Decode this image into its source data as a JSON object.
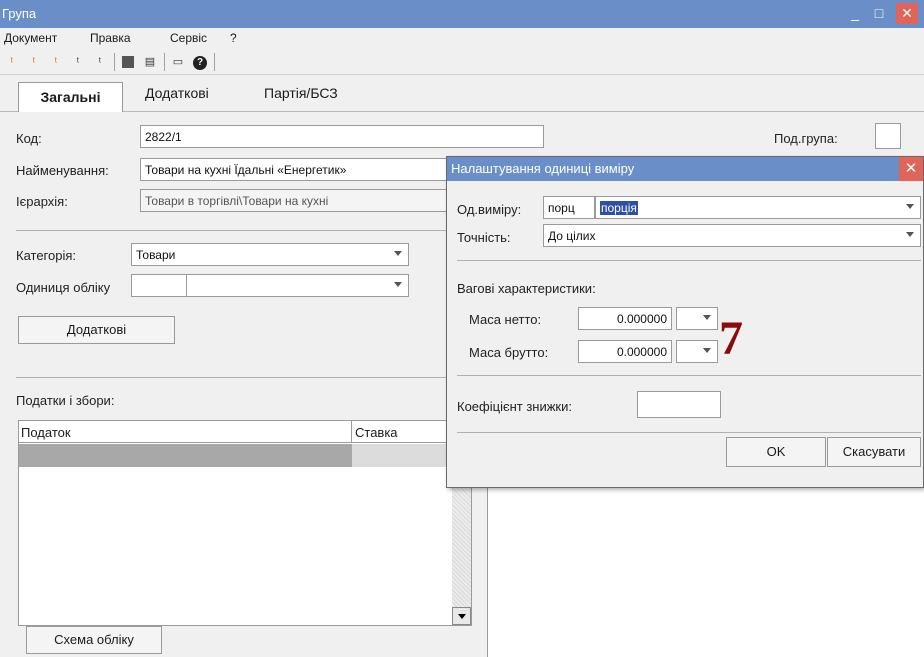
{
  "window": {
    "title": "Група",
    "minimize": "_",
    "maximize": "□",
    "close": "✕"
  },
  "menu": [
    "Документ",
    "Правка",
    "Сервіс",
    "?"
  ],
  "toolbar_icons": [
    "new-doc-icon",
    "new-child-icon",
    "new-copy-icon",
    "new-group-icon",
    "new-item-icon",
    "stop-icon",
    "report-icon",
    "window-icon",
    "help-icon"
  ],
  "tabs": [
    "Загальні",
    "Додаткові",
    "Партія/БСЗ"
  ],
  "form": {
    "code_label": "Код:",
    "code_value": "2822/1",
    "subgroup_label": "Под.група:",
    "name_label": "Найменування:",
    "name_value": "Товари на кухні Їдальні «Енергетик»",
    "hierarchy_label": "Ієрархія:",
    "hierarchy_value": "Товари в  торгівлі\\Товари на кухні",
    "category_label": "Категорія:",
    "category_value": "Товари",
    "unit_label": "Одиниця обліку",
    "additional_button": "Додаткові",
    "taxes_label": "Податки і збори:",
    "taxes_columns": [
      "Податок",
      "Ставка"
    ],
    "scheme_button": "Схема обліку"
  },
  "dialog": {
    "title": "Налаштування одиниці виміру",
    "close": "✕",
    "unit_label": "Од.виміру:",
    "unit_code": "порц",
    "unit_name": "порція",
    "precision_label": "Точність:",
    "precision_value": "До цілих",
    "weight_section": "Вагові характеристики:",
    "net_label": "Маса нетто:",
    "net_value": "0.000000",
    "gross_label": "Маса брутто:",
    "gross_value": "0.000000",
    "discount_label": "Коефіцієнт знижки:",
    "ok_button": "OK",
    "cancel_button": "Скасувати"
  },
  "annotation": "7",
  "colors": {
    "titlebar": "#6a8fc8",
    "selection": "#2d4fa8",
    "annotation": "#8b0a0a",
    "close": "#e0645a"
  }
}
